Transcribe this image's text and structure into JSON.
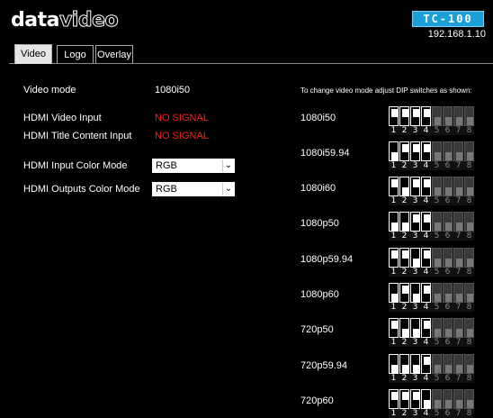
{
  "header": {
    "logo_part1": "data",
    "logo_part2": "video",
    "model": "TC-100",
    "ip": "192.168.1.10"
  },
  "tabs": [
    {
      "label": "Video",
      "active": true
    },
    {
      "label": "Logo",
      "active": false
    },
    {
      "label": "Overlay",
      "active": false
    }
  ],
  "settings": {
    "video_mode_label": "Video mode",
    "video_mode_value": "1080i50",
    "hdmi_video_input_label": "HDMI Video Input",
    "hdmi_video_input_value": "NO SIGNAL",
    "hdmi_title_input_label": "HDMI Title Content Input",
    "hdmi_title_input_value": "NO SIGNAL",
    "input_color_mode_label": "HDMI Input Color Mode",
    "input_color_mode_value": "RGB",
    "outputs_color_mode_label": "HDMI Outputs Color Mode",
    "outputs_color_mode_value": "RGB"
  },
  "colors": {
    "no_signal": "#ff1e1e",
    "badge": "#1a9fd8"
  },
  "dip_hint": "To change video mode adjust DIP switches as shown:",
  "dip_modes": [
    {
      "label": "1080i50",
      "switches": [
        1,
        1,
        1,
        1,
        0,
        0,
        0,
        0
      ]
    },
    {
      "label": "1080i59.94",
      "switches": [
        0,
        1,
        1,
        1,
        0,
        0,
        0,
        0
      ]
    },
    {
      "label": "1080i60",
      "switches": [
        1,
        0,
        1,
        1,
        0,
        0,
        0,
        0
      ]
    },
    {
      "label": "1080p50",
      "switches": [
        0,
        0,
        1,
        1,
        0,
        0,
        0,
        0
      ]
    },
    {
      "label": "1080p59.94",
      "switches": [
        1,
        1,
        0,
        1,
        0,
        0,
        0,
        0
      ]
    },
    {
      "label": "1080p60",
      "switches": [
        0,
        1,
        0,
        1,
        0,
        0,
        0,
        0
      ]
    },
    {
      "label": "720p50",
      "switches": [
        1,
        0,
        0,
        1,
        0,
        0,
        0,
        0
      ]
    },
    {
      "label": "720p59.94",
      "switches": [
        0,
        0,
        0,
        1,
        0,
        0,
        0,
        0
      ]
    },
    {
      "label": "720p60",
      "switches": [
        1,
        1,
        1,
        0,
        0,
        0,
        0,
        0
      ]
    }
  ],
  "dip_numbers": [
    "1",
    "2",
    "3",
    "4",
    "5",
    "6",
    "7",
    "8"
  ]
}
